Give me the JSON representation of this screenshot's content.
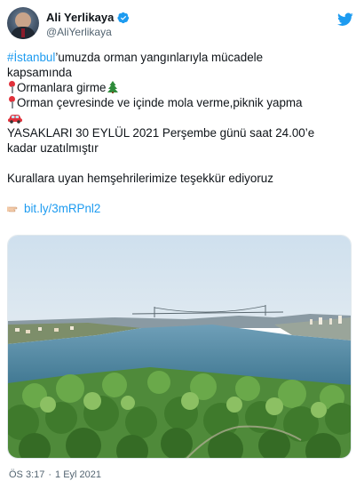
{
  "tweet": {
    "author_name": "Ali Yerlikaya",
    "author_handle": "@AliYerlikaya",
    "hashtag": "#İstanbul",
    "line1_rest": "’umuzda orman yangınlarıyla mücadele",
    "line2": "kapsamında",
    "rule1": "Ormanlara girme",
    "rule2": "Orman çevresinde ve içinde mola verme,piknik yapma",
    "notice_line1": "YASAKLARI 30 EYLÜL 2021 Perşembe günü saat 24.00’e",
    "notice_line2": "kadar uzatılmıştır",
    "thanks": "Kurallara uyan hemşehrilerimize teşekkür ediyoruz",
    "link": "bit.ly/3mRPnl2",
    "time": "ÖS 3:17",
    "separator": "·",
    "date": "1 Eyl 2021"
  },
  "icons": {
    "verified": "verified-badge-icon",
    "twitter": "twitter-bird-icon",
    "pin": "round-pushpin-icon",
    "tree": "evergreen-tree-icon",
    "car": "car-icon",
    "hand": "pointing-hand-icon"
  },
  "colors": {
    "accent": "#1d9bf0",
    "text": "#0f1419",
    "muted": "#536471"
  }
}
